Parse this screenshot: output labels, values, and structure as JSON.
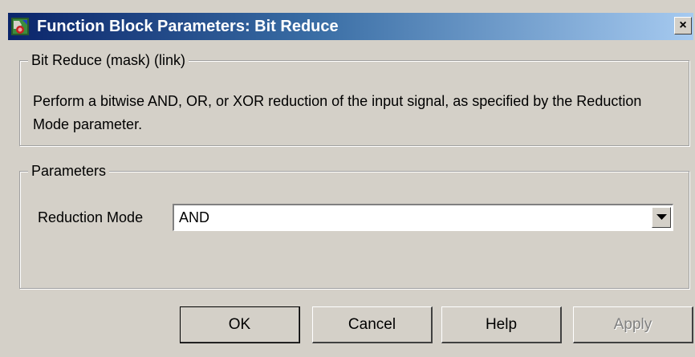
{
  "window": {
    "title": "Function Block Parameters: Bit Reduce",
    "close_label": "×",
    "icon": "simulink-block-icon"
  },
  "description": {
    "legend": "Bit Reduce (mask) (link)",
    "text": "Perform a bitwise AND, OR, or XOR reduction of the input signal, as specified by the Reduction Mode parameter."
  },
  "parameters": {
    "legend": "Parameters",
    "reduction_mode": {
      "label": "Reduction Mode",
      "value": "AND"
    }
  },
  "buttons": {
    "ok": "OK",
    "cancel": "Cancel",
    "help": "Help",
    "apply": "Apply"
  },
  "colors": {
    "title_gradient_start": "#0a246a",
    "title_gradient_end": "#a6caf0",
    "window_bg": "#d4d0c8"
  }
}
